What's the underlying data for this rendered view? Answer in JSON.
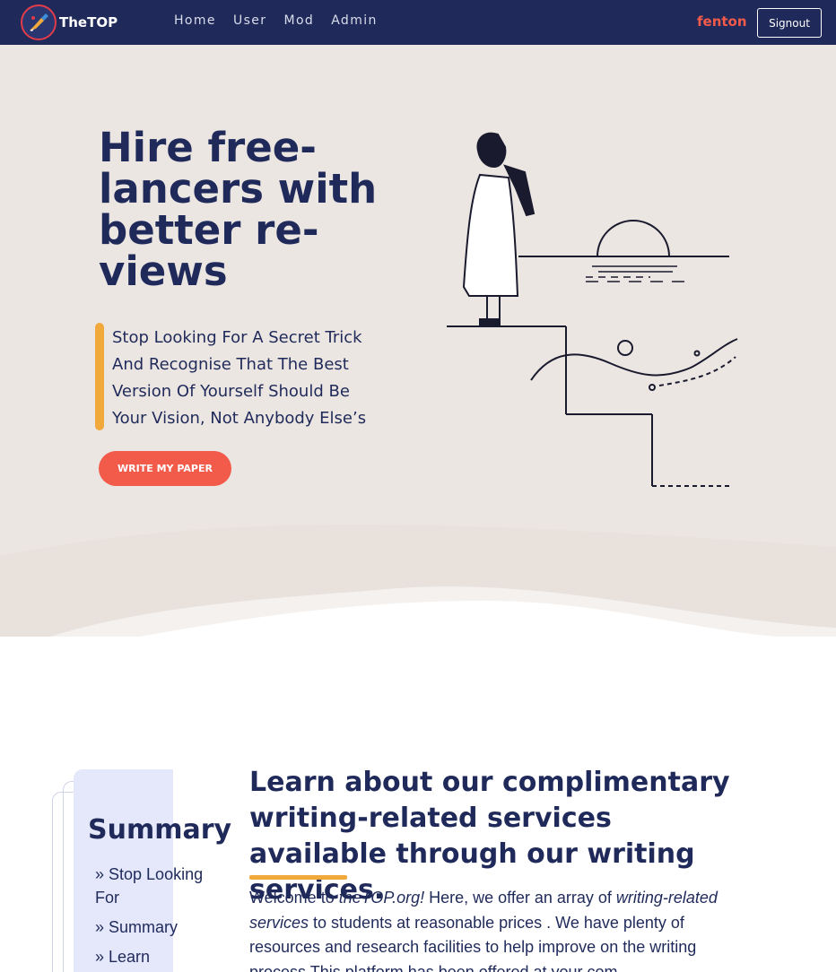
{
  "navbar": {
    "brand": "TheTOP",
    "links": [
      "Home",
      "User",
      "Mod",
      "Admin"
    ],
    "username": "fenton",
    "signout_label": "Signout"
  },
  "hero": {
    "title": "Hire free-lancers with better re-views",
    "tagline": "Stop Looking For A Secret Trick And Recognise That The Best Version Of Yourself Should Be Your Vision, Not Anybody Else’s",
    "cta_label": "WRITE MY PAPER"
  },
  "summary": {
    "title": "Summary",
    "items": [
      "» Stop Looking For",
      "» Summary",
      "» Learn"
    ]
  },
  "section": {
    "title": "Learn about our complimentary writing-related services available through our writing services.",
    "body_parts": {
      "p1": "Welcome to ",
      "site": "theTOP.org!",
      "p2": " Here, we offer an array of ",
      "services": "writing-related services",
      "p3": " to students at reasonable prices . We have plenty of resources and research facilities to help improve on the writing process This platform has been offered at your com-"
    }
  },
  "colors": {
    "navy": "#1f2a5a",
    "accent_red": "#f25a4a",
    "accent_orange": "#f2a93b",
    "hero_bg": "#ece6e2"
  },
  "icons": [
    "brand-logo-icon"
  ]
}
